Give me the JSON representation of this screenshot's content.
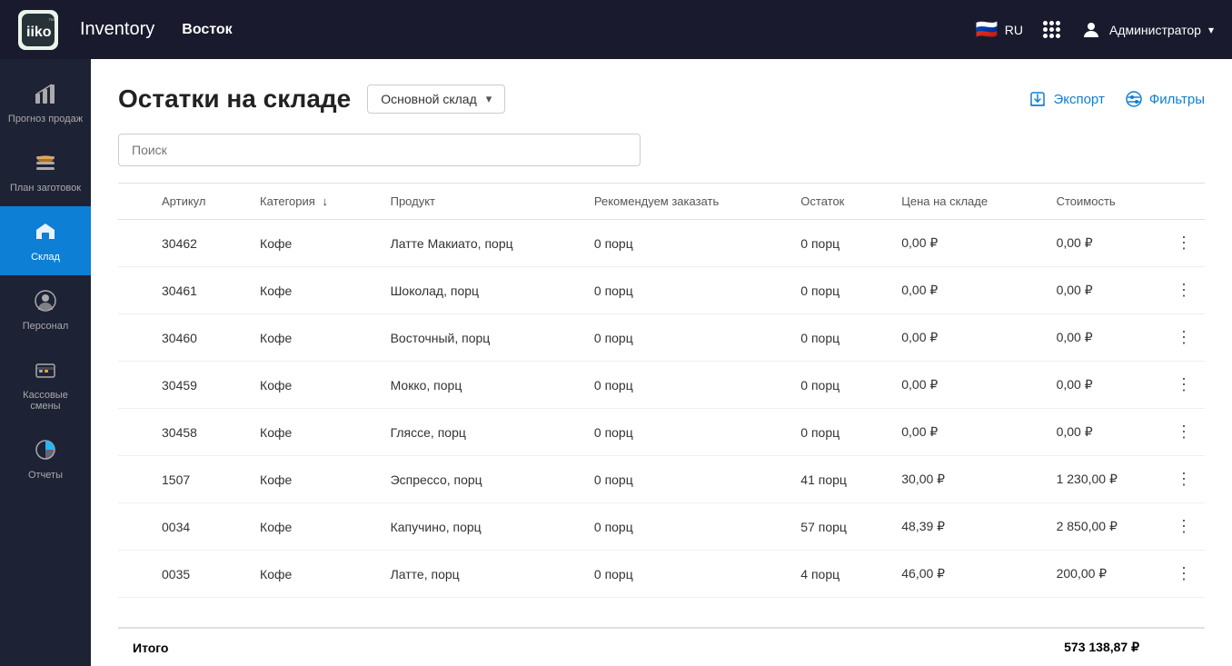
{
  "app": {
    "logo": "iiko",
    "logo_tm": "™",
    "title": "Inventory",
    "location": "Восток"
  },
  "topnav": {
    "language": "RU",
    "user": "Администратор",
    "user_icon": "person-icon",
    "chevron": "▾"
  },
  "sidebar": {
    "items": [
      {
        "id": "forecast",
        "label": "Прогноз продаж",
        "icon": "chart-icon"
      },
      {
        "id": "prep",
        "label": "План заготовок",
        "icon": "burger-icon"
      },
      {
        "id": "warehouse",
        "label": "Склад",
        "icon": "warehouse-icon",
        "active": true
      },
      {
        "id": "staff",
        "label": "Персонал",
        "icon": "person-circle-icon"
      },
      {
        "id": "cashier",
        "label": "Кассовые смены",
        "icon": "cashier-icon"
      },
      {
        "id": "reports",
        "label": "Отчеты",
        "icon": "pie-icon"
      }
    ]
  },
  "page": {
    "title": "Остатки на складе",
    "warehouse_label": "Основной склад",
    "export_label": "Экспорт",
    "filter_label": "Фильтры",
    "search_placeholder": "Поиск"
  },
  "table": {
    "columns": [
      {
        "id": "article",
        "label": "Артикул",
        "sortable": false
      },
      {
        "id": "category",
        "label": "Категория",
        "sortable": true
      },
      {
        "id": "product",
        "label": "Продукт",
        "sortable": false
      },
      {
        "id": "recommend",
        "label": "Рекомендуем заказать",
        "sortable": false
      },
      {
        "id": "stock",
        "label": "Остаток",
        "sortable": false
      },
      {
        "id": "price",
        "label": "Цена на складе",
        "sortable": false
      },
      {
        "id": "cost",
        "label": "Стоимость",
        "sortable": false
      }
    ],
    "rows": [
      {
        "article": "30462",
        "category": "Кофе",
        "product": "Латте Макиато, порц",
        "recommend": "0 порц",
        "stock": "0 порц",
        "price": "0,00 ₽",
        "cost": "0,00 ₽"
      },
      {
        "article": "30461",
        "category": "Кофе",
        "product": "Шоколад, порц",
        "recommend": "0 порц",
        "stock": "0 порц",
        "price": "0,00 ₽",
        "cost": "0,00 ₽"
      },
      {
        "article": "30460",
        "category": "Кофе",
        "product": "Восточный, порц",
        "recommend": "0 порц",
        "stock": "0 порц",
        "price": "0,00 ₽",
        "cost": "0,00 ₽"
      },
      {
        "article": "30459",
        "category": "Кофе",
        "product": "Мокко, порц",
        "recommend": "0 порц",
        "stock": "0 порц",
        "price": "0,00 ₽",
        "cost": "0,00 ₽"
      },
      {
        "article": "30458",
        "category": "Кофе",
        "product": "Гляссе, порц",
        "recommend": "0 порц",
        "stock": "0 порц",
        "price": "0,00 ₽",
        "cost": "0,00 ₽"
      },
      {
        "article": "1507",
        "category": "Кофе",
        "product": "Эспрессо, порц",
        "recommend": "0 порц",
        "stock": "41 порц",
        "price": "30,00 ₽",
        "cost": "1 230,00 ₽"
      },
      {
        "article": "0034",
        "category": "Кофе",
        "product": "Капучино, порц",
        "recommend": "0 порц",
        "stock": "57 порц",
        "price": "48,39 ₽",
        "cost": "2 850,00 ₽"
      },
      {
        "article": "0035",
        "category": "Кофе",
        "product": "Латте, порц",
        "recommend": "0 порц",
        "stock": "4 порц",
        "price": "46,00 ₽",
        "cost": "200,00 ₽"
      }
    ],
    "footer": {
      "label": "Итого",
      "total": "573 138,87 ₽"
    }
  }
}
